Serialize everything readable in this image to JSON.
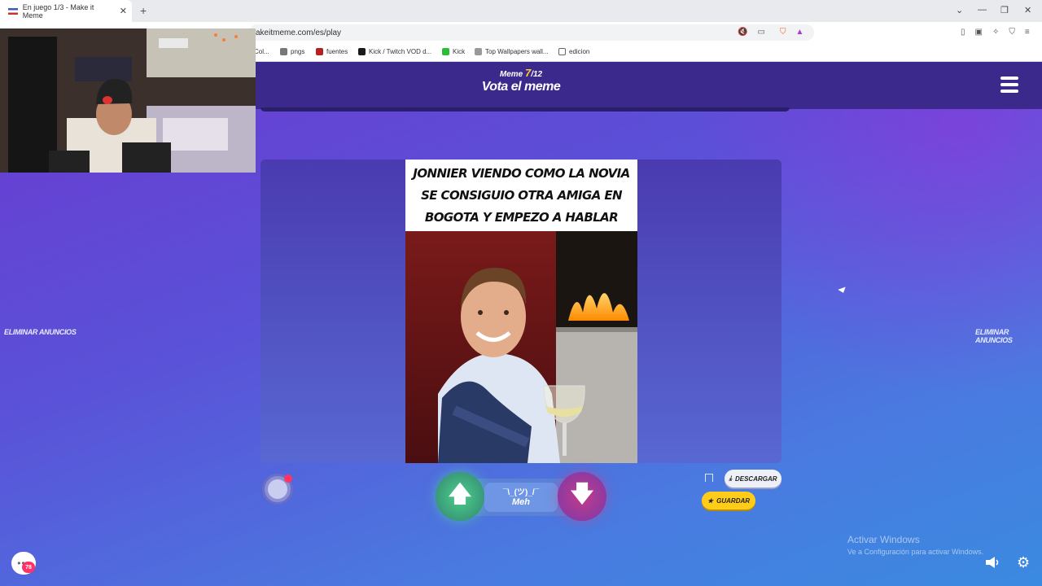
{
  "browser": {
    "tab_title": "En juego 1/3 - Make it Meme",
    "tab_close": "✕",
    "new_tab": "+",
    "url": "akeitmeme.com/es/play",
    "bookmarks": [
      {
        "label": "Col...",
        "color": "#888888"
      },
      {
        "label": "pngs",
        "color": "#777777"
      },
      {
        "label": "fuentes",
        "color": "#b22222"
      },
      {
        "label": "Kick / Twitch VOD d...",
        "color": "#1a1a1a"
      },
      {
        "label": "Kick",
        "color": "#2bbd3a"
      },
      {
        "label": "Top Wallpapers wall...",
        "color": "#999999"
      },
      {
        "label": "edicion",
        "color": "#666666"
      }
    ]
  },
  "game": {
    "round_prefix": "Meme ",
    "round_current": "7",
    "round_total": "/12",
    "heading": "Vota el meme",
    "remove_ads_left": "Eliminar anuncios",
    "remove_ads_right": "Eliminar anuncios",
    "meme_caption": "Jonnier viendo como la novia se consiguio otra amiga en Bogota y empezo a hablar mierda de el otra vez",
    "vote_up": "🡅",
    "vote_down": "🡇",
    "meh_face": "¯\\_(ツ)_/¯",
    "meh_label": "Meh",
    "download_label": "DESCARGAR",
    "save_label": "GUARDAR",
    "chat_count": "78"
  },
  "os": {
    "activate_title": "Activar Windows",
    "activate_sub": "Ve a Configuración para activar Windows."
  },
  "colors": {
    "accent_yellow": "#ffcc1a",
    "topbar": "#3b2a8c",
    "vote_up": "#4ccf8c",
    "vote_down": "#c43a8a"
  }
}
